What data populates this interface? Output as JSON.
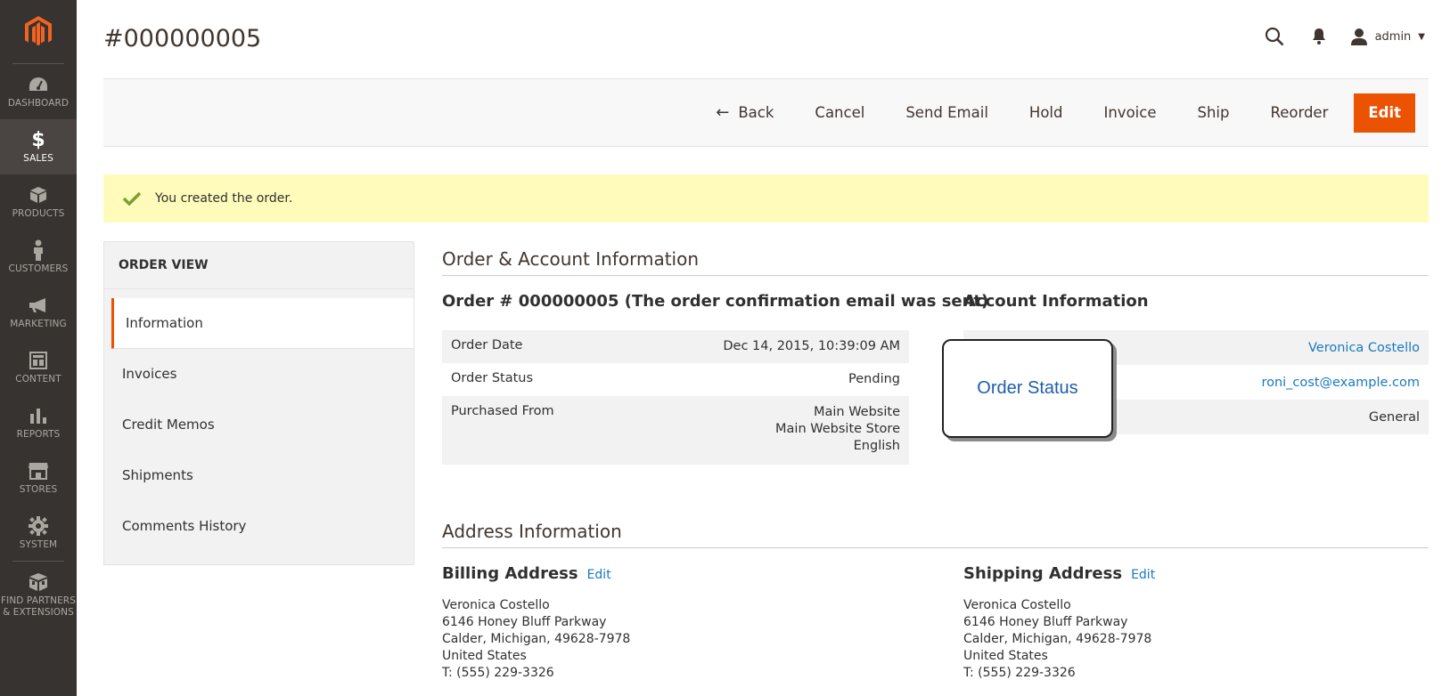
{
  "sidebar": {
    "logo": "magento-logo",
    "items": [
      {
        "label": "DASHBOARD",
        "icon": "dashboard-icon"
      },
      {
        "label": "SALES",
        "icon": "dollar-icon"
      },
      {
        "label": "PRODUCTS",
        "icon": "box-icon"
      },
      {
        "label": "CUSTOMERS",
        "icon": "person-icon"
      },
      {
        "label": "MARKETING",
        "icon": "megaphone-icon"
      },
      {
        "label": "CONTENT",
        "icon": "layout-icon"
      },
      {
        "label": "REPORTS",
        "icon": "bar-chart-icon"
      },
      {
        "label": "STORES",
        "icon": "store-icon"
      },
      {
        "label": "SYSTEM",
        "icon": "gear-icon"
      },
      {
        "label": "FIND PARTNERS & EXTENSIONS",
        "icon": "extensions-icon"
      }
    ],
    "active": "SALES"
  },
  "header": {
    "title": "#000000005",
    "user": "admin"
  },
  "toolbar": {
    "back": "Back",
    "cancel": "Cancel",
    "send_email": "Send Email",
    "hold": "Hold",
    "invoice": "Invoice",
    "ship": "Ship",
    "reorder": "Reorder",
    "edit": "Edit"
  },
  "message": "You created the order.",
  "order_view": {
    "title": "ORDER VIEW",
    "tabs": [
      "Information",
      "Invoices",
      "Credit Memos",
      "Shipments",
      "Comments History"
    ]
  },
  "main": {
    "section_title": "Order & Account Information",
    "order_heading": "Order # 000000005 (The order confirmation email was sent)",
    "order_date_label": "Order Date",
    "order_date": "Dec 14, 2015, 10:39:09 AM",
    "order_status_label": "Order Status",
    "order_status": "Pending",
    "purchased_from_label": "Purchased From",
    "purchased_from": [
      "Main Website",
      "Main Website Store",
      "English"
    ],
    "account_heading": "Account Information",
    "customer_name": "Veronica Costello",
    "email": "roni_cost@example.com",
    "customer_group": "General",
    "callout": "Order Status"
  },
  "address": {
    "section_title": "Address Information",
    "billing": {
      "heading": "Billing Address",
      "edit": "Edit",
      "lines": [
        "Veronica Costello",
        "6146 Honey Bluff Parkway",
        "Calder, Michigan, 49628-7978",
        "United States",
        "T: (555) 229-3326"
      ]
    },
    "shipping": {
      "heading": "Shipping Address",
      "edit": "Edit",
      "lines": [
        "Veronica Costello",
        "6146 Honey Bluff Parkway",
        "Calder, Michigan, 49628-7978",
        "United States",
        "T: (555) 229-3326"
      ]
    }
  },
  "colors": {
    "accent": "#eb5202",
    "sidebar": "#373330",
    "link": "#1979c3",
    "message_bg": "#fffbbb"
  }
}
